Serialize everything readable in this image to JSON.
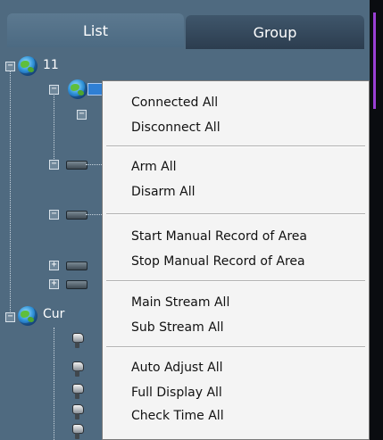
{
  "tabs": {
    "list_label": "List",
    "group_label": "Group"
  },
  "tree": {
    "root_label": "11",
    "second_root_label": "Cur"
  },
  "menu": {
    "groups": [
      [
        "Connected All",
        "Disconnect All"
      ],
      [
        "Arm All",
        "Disarm All"
      ],
      [
        "Start Manual Record of Area",
        "Stop Manual Record of Area"
      ],
      [
        "Main Stream All",
        "Sub Stream All"
      ],
      [
        "Auto Adjust All",
        "Full Display All",
        "Check Time All"
      ]
    ]
  },
  "colors": {
    "panel": "#4f6a80",
    "menu_bg": "#f4f4f4",
    "accent_purple": "#9a3fd4",
    "selection": "#2f7fd4"
  },
  "icons": [
    "globe-icon",
    "dvr-icon",
    "camera-icon",
    "expander-plus-icon",
    "expander-minus-icon"
  ]
}
